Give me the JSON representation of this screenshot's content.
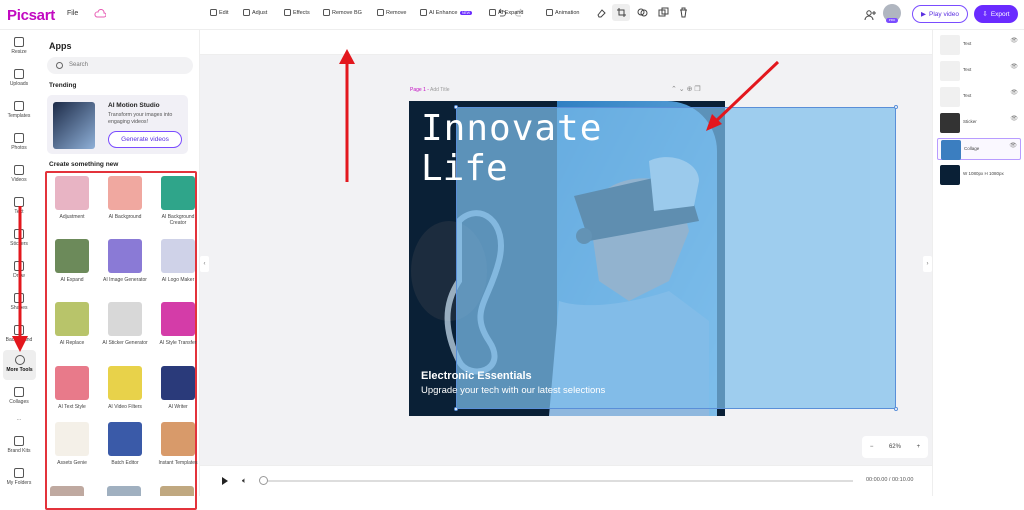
{
  "header": {
    "logo": "Picsart",
    "file": "File",
    "play_label": "Play video",
    "export_label": "Export",
    "avatar_badge": "PRO"
  },
  "nav": [
    {
      "label": "Resize",
      "icon": "resize-icon"
    },
    {
      "label": "Uploads",
      "icon": "upload-icon"
    },
    {
      "label": "Templates",
      "icon": "templates-icon"
    },
    {
      "label": "Photos",
      "icon": "photos-icon"
    },
    {
      "label": "Videos",
      "icon": "videos-icon"
    },
    {
      "label": "Text",
      "icon": "text-icon"
    },
    {
      "label": "Stickers",
      "icon": "stickers-icon"
    },
    {
      "label": "Draw",
      "icon": "draw-icon"
    },
    {
      "label": "Shapes",
      "icon": "shapes-icon"
    },
    {
      "label": "Background",
      "icon": "background-icon"
    },
    {
      "label": "More Tools",
      "icon": "more-tools-icon"
    },
    {
      "label": "Collages",
      "icon": "collages-icon"
    },
    {
      "label": "...",
      "icon": "dots-icon"
    },
    {
      "label": "Brand Kits",
      "icon": "brand-kit-icon"
    },
    {
      "label": "My Folders",
      "icon": "folder-icon"
    }
  ],
  "apps": {
    "title": "Apps",
    "search_placeholder": "Search",
    "trending": "Trending",
    "promo_title": "AI Motion Studio",
    "promo_sub": "Transform your images into engaging videos!",
    "promo_btn": "Generate videos",
    "create": "Create something new",
    "tiles": [
      {
        "label": "Adjustment",
        "color": "#e8b4c4"
      },
      {
        "label": "AI Background",
        "color": "#f0a8a0"
      },
      {
        "label": "AI Background Creator",
        "color": "#2fa58a"
      },
      {
        "label": "AI Expand",
        "color": "#6c8a5a"
      },
      {
        "label": "AI Image Generator",
        "color": "#8a7ad6"
      },
      {
        "label": "AI Logo Maker",
        "color": "#cfd2e8"
      },
      {
        "label": "AI Replace",
        "color": "#b8c46a"
      },
      {
        "label": "AI Sticker Generator",
        "color": "#d8d8d8"
      },
      {
        "label": "AI Style Transfer",
        "color": "#d43ca8"
      },
      {
        "label": "AI Text Style",
        "color": "#e87a8a"
      },
      {
        "label": "AI Video Filters",
        "color": "#e8d24a"
      },
      {
        "label": "AI Writer",
        "color": "#2a3a7a"
      },
      {
        "label": "Assets Genie",
        "color": "#f4f0e8"
      },
      {
        "label": "Batch Editor",
        "color": "#3a5aa8"
      },
      {
        "label": "Instant Templates",
        "color": "#d89a6a"
      }
    ]
  },
  "toolbar": [
    {
      "label": "Edit"
    },
    {
      "label": "Adjust"
    },
    {
      "label": "Effects"
    },
    {
      "label": "Remove BG"
    },
    {
      "label": "Remove"
    },
    {
      "label": "AI Enhance",
      "tag": "NEW"
    },
    {
      "label": "AI Expand"
    },
    {
      "label": "Animation"
    }
  ],
  "canvas": {
    "page_label": "Page 1",
    "page_title": "Add Title",
    "title_line1": "Innovate",
    "title_line2": "Life",
    "subtitle": "Electronic Essentials",
    "tagline": "Upgrade your tech with our latest selections",
    "zoom": "62%"
  },
  "layers": [
    {
      "label": "Text",
      "color": "#f0f0f0"
    },
    {
      "label": "Text",
      "color": "#f0f0f0"
    },
    {
      "label": "Text",
      "color": "#f0f0f0"
    },
    {
      "label": "Sticker",
      "color": "#333"
    },
    {
      "label": "Collage",
      "color": "#3b7ec0"
    },
    {
      "label": "W 1080px H 1080px",
      "color": "#0a2036"
    }
  ],
  "timeline": {
    "time": "00:00.00 / 00:10.00"
  }
}
